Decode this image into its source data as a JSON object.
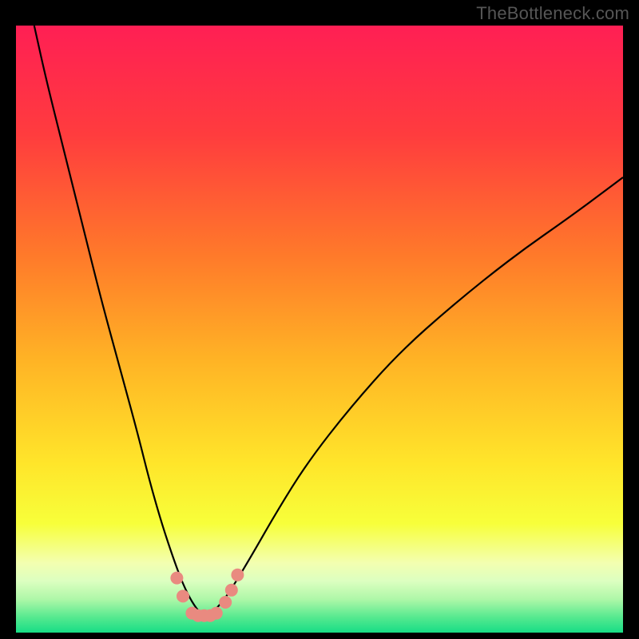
{
  "watermark": "TheBottleneck.com",
  "chart_data": {
    "type": "line",
    "title": "",
    "xlabel": "",
    "ylabel": "",
    "xlim": [
      0,
      100
    ],
    "ylim": [
      0,
      100
    ],
    "grid": false,
    "legend": false,
    "background_gradient_stops": [
      {
        "offset": 0.0,
        "color": "#ff1f54"
      },
      {
        "offset": 0.18,
        "color": "#ff3c3e"
      },
      {
        "offset": 0.38,
        "color": "#ff7a2a"
      },
      {
        "offset": 0.55,
        "color": "#ffb325"
      },
      {
        "offset": 0.72,
        "color": "#ffe52a"
      },
      {
        "offset": 0.82,
        "color": "#f7ff3a"
      },
      {
        "offset": 0.885,
        "color": "#f3ffb0"
      },
      {
        "offset": 0.915,
        "color": "#dcffc0"
      },
      {
        "offset": 0.945,
        "color": "#aef7a8"
      },
      {
        "offset": 0.975,
        "color": "#55e98f"
      },
      {
        "offset": 1.0,
        "color": "#17dd86"
      }
    ],
    "series": [
      {
        "name": "bottleneck-curve",
        "stroke": "#000000",
        "stroke_width": 2.2,
        "x": [
          3,
          5,
          8,
          11,
          14,
          17,
          20,
          22,
          24,
          26,
          27.5,
          29,
          30.5,
          32,
          34,
          36,
          39,
          43,
          48,
          55,
          63,
          72,
          82,
          92,
          100
        ],
        "y": [
          100,
          91,
          79,
          67,
          55,
          44,
          33,
          25,
          18,
          12,
          8,
          5,
          3,
          3,
          5,
          8,
          13,
          20,
          28,
          37,
          46,
          54,
          62,
          69,
          75
        ]
      },
      {
        "name": "highlight-markers",
        "type": "scatter",
        "marker_color": "#e98a80",
        "marker_radius": 8,
        "x": [
          26.5,
          27.5,
          29,
          30,
          31,
          32,
          33,
          34.5,
          35.5,
          36.5
        ],
        "y": [
          9,
          6,
          3.2,
          2.8,
          2.8,
          2.8,
          3.2,
          5,
          7,
          9.5
        ]
      }
    ]
  }
}
